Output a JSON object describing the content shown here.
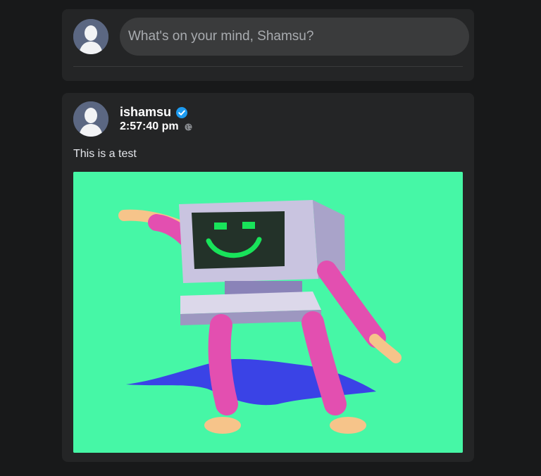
{
  "composer": {
    "placeholder": "What's on your mind, Shamsu?"
  },
  "post": {
    "author": "ishamsu",
    "verified": true,
    "timestamp": "2:57:40 pm",
    "visibility_icon": "globe-icon",
    "text": "This is a test",
    "image_description_icon": "robot-computer-illustration"
  },
  "colors": {
    "page_bg": "#18191a",
    "card_bg": "#242526",
    "input_bg": "#3a3b3c",
    "verified_blue": "#1d9bf0",
    "image_bg": "#46f7a6"
  }
}
